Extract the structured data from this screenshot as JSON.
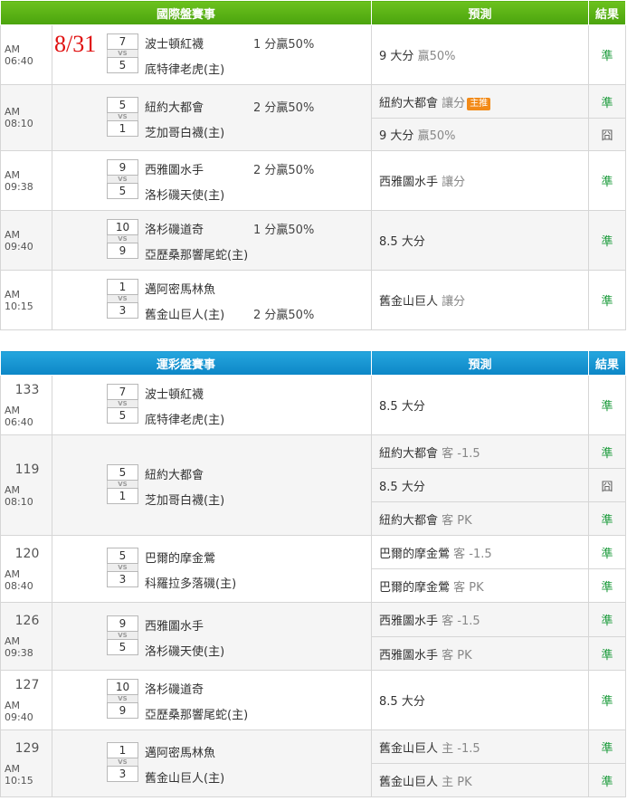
{
  "section1": {
    "header": {
      "title": "國際盤賽事",
      "predict": "預測",
      "result": "結果"
    },
    "date_mark": "8/31",
    "matches": [
      {
        "time": "AM 06:40",
        "away": "波士頓紅襪",
        "away_score": "7",
        "home": "底特律老虎(主)",
        "home_score": "5",
        "odds": "1 分贏50%",
        "odds_row": "away",
        "preds": [
          {
            "text": "9 大分",
            "extra": "贏50%",
            "result": "準"
          }
        ]
      },
      {
        "time": "AM 08:10",
        "away": "紐約大都會",
        "away_score": "5",
        "home": "芝加哥白襪(主)",
        "home_score": "1",
        "odds": "2 分贏50%",
        "odds_row": "away",
        "preds": [
          {
            "text": "紐約大都會",
            "extra": "讓分",
            "badge": "主推",
            "result": "準"
          },
          {
            "text": "9 大分",
            "extra": "贏50%",
            "result": "囧"
          }
        ]
      },
      {
        "time": "AM 09:38",
        "away": "西雅圖水手",
        "away_score": "9",
        "home": "洛杉磯天使(主)",
        "home_score": "5",
        "odds": "2 分贏50%",
        "odds_row": "away",
        "preds": [
          {
            "text": "西雅圖水手",
            "extra": "讓分",
            "result": "準"
          }
        ]
      },
      {
        "time": "AM 09:40",
        "away": "洛杉磯道奇",
        "away_score": "10",
        "home": "亞歷桑那響尾蛇(主)",
        "home_score": "9",
        "odds": "1 分贏50%",
        "odds_row": "away",
        "preds": [
          {
            "text": "8.5 大分",
            "extra": "",
            "result": "準"
          }
        ]
      },
      {
        "time": "AM 10:15",
        "away": "邁阿密馬林魚",
        "away_score": "1",
        "home": "舊金山巨人(主)",
        "home_score": "3",
        "odds": "2 分贏50%",
        "odds_row": "home",
        "preds": [
          {
            "text": "舊金山巨人",
            "extra": "讓分",
            "result": "準"
          }
        ]
      }
    ]
  },
  "section2": {
    "header": {
      "title": "運彩盤賽事",
      "predict": "預測",
      "result": "結果"
    },
    "matches": [
      {
        "num": "133",
        "time": "AM 06:40",
        "away": "波士頓紅襪",
        "away_score": "7",
        "home": "底特律老虎(主)",
        "home_score": "5",
        "preds": [
          {
            "text": "8.5 大分",
            "extra": "",
            "result": "準"
          }
        ]
      },
      {
        "num": "119",
        "time": "AM 08:10",
        "away": "紐約大都會",
        "away_score": "5",
        "home": "芝加哥白襪(主)",
        "home_score": "1",
        "preds": [
          {
            "text": "紐約大都會",
            "extra": "客 -1.5",
            "result": "準"
          },
          {
            "text": "8.5 大分",
            "extra": "",
            "result": "囧"
          },
          {
            "text": "紐約大都會",
            "extra": "客 PK",
            "result": "準"
          }
        ]
      },
      {
        "num": "120",
        "time": "AM 08:40",
        "away": "巴爾的摩金鶯",
        "away_score": "5",
        "home": "科羅拉多落磯(主)",
        "home_score": "3",
        "preds": [
          {
            "text": "巴爾的摩金鶯",
            "extra": "客 -1.5",
            "result": "準"
          },
          {
            "text": "巴爾的摩金鶯",
            "extra": "客 PK",
            "result": "準"
          }
        ]
      },
      {
        "num": "126",
        "time": "AM 09:38",
        "away": "西雅圖水手",
        "away_score": "9",
        "home": "洛杉磯天使(主)",
        "home_score": "5",
        "preds": [
          {
            "text": "西雅圖水手",
            "extra": "客 -1.5",
            "result": "準"
          },
          {
            "text": "西雅圖水手",
            "extra": "客 PK",
            "result": "準"
          }
        ]
      },
      {
        "num": "127",
        "time": "AM 09:40",
        "away": "洛杉磯道奇",
        "away_score": "10",
        "home": "亞歷桑那響尾蛇(主)",
        "home_score": "9",
        "preds": [
          {
            "text": "8.5 大分",
            "extra": "",
            "result": "準"
          }
        ]
      },
      {
        "num": "129",
        "time": "AM 10:15",
        "away": "邁阿密馬林魚",
        "away_score": "1",
        "home": "舊金山巨人(主)",
        "home_score": "3",
        "preds": [
          {
            "text": "舊金山巨人",
            "extra": "主 -1.5",
            "result": "準"
          },
          {
            "text": "舊金山巨人",
            "extra": "主 PK",
            "result": "準"
          }
        ]
      }
    ]
  }
}
